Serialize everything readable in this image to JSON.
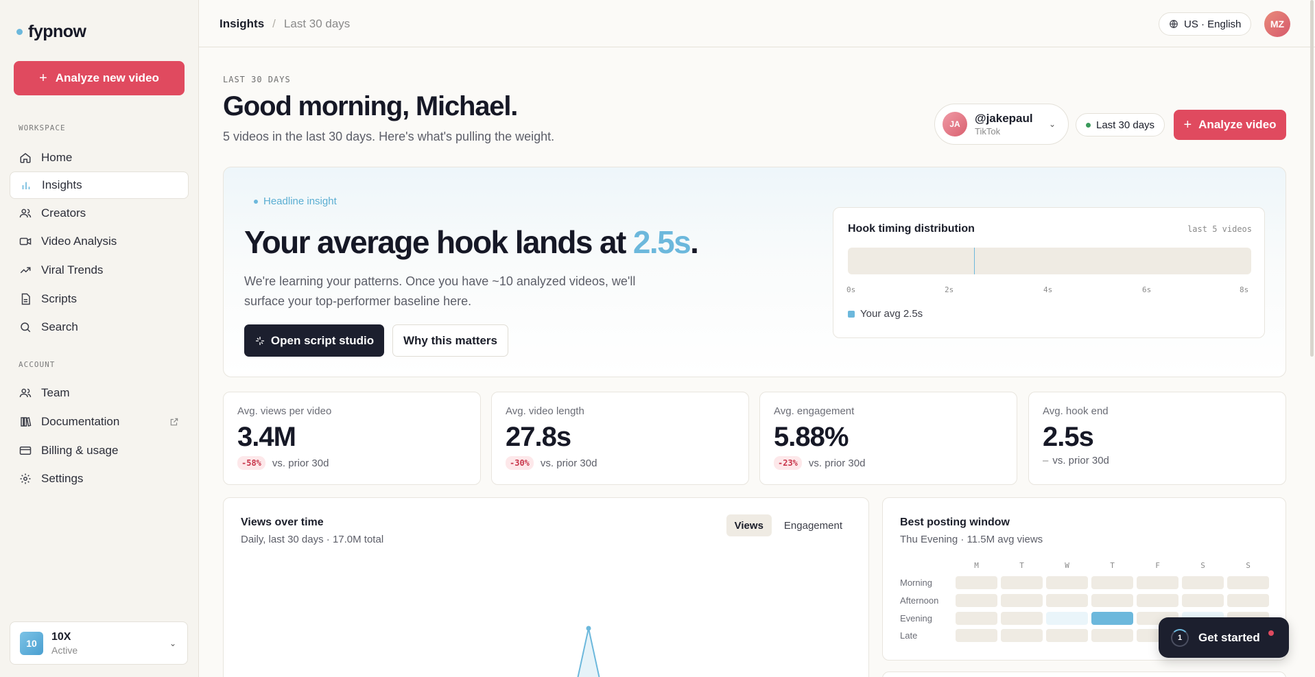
{
  "app": {
    "name": "fypnow"
  },
  "sidebar": {
    "cta": "Analyze new video",
    "workspace_label": "WORKSPACE",
    "account_label": "ACCOUNT",
    "workspace_items": [
      {
        "label": "Home",
        "icon": "home-icon"
      },
      {
        "label": "Insights",
        "icon": "bar-chart-icon",
        "active": true
      },
      {
        "label": "Creators",
        "icon": "users-icon"
      },
      {
        "label": "Video Analysis",
        "icon": "video-icon"
      },
      {
        "label": "Viral Trends",
        "icon": "trending-up-icon"
      },
      {
        "label": "Scripts",
        "icon": "document-icon"
      },
      {
        "label": "Search",
        "icon": "search-icon"
      }
    ],
    "account_items": [
      {
        "label": "Team",
        "icon": "users-icon"
      },
      {
        "label": "Documentation",
        "icon": "book-icon",
        "external": true
      },
      {
        "label": "Billing & usage",
        "icon": "credit-card-icon"
      },
      {
        "label": "Settings",
        "icon": "gear-icon"
      }
    ],
    "workspace_switcher": {
      "badge": "10",
      "name": "10X",
      "status": "Active"
    }
  },
  "topbar": {
    "breadcrumb": [
      "Insights",
      "Last 30 days"
    ],
    "language": "US · English",
    "user_initials": "MZ"
  },
  "header": {
    "eyebrow": "LAST 30 DAYS",
    "greeting": "Good morning, Michael.",
    "subtitle": "5 videos in the last 30 days. Here's what's pulling the weight.",
    "account": {
      "initials": "JA",
      "handle": "@jakepaul",
      "platform": "TikTok"
    },
    "range": "Last 30 days",
    "analyze_button": "Analyze video"
  },
  "headline": {
    "tag": "Headline insight",
    "title_prefix": "Your average hook lands at ",
    "title_value": "2.5s",
    "title_suffix": ".",
    "body": "We're learning your patterns. Once you have ~10 analyzed videos, we'll surface your top-performer baseline here.",
    "primary_button": "Open script studio",
    "secondary_button": "Why this matters",
    "hook_chart": {
      "title": "Hook timing distribution",
      "subtitle": "last 5 videos",
      "ticks": [
        "0s",
        "2s",
        "4s",
        "6s",
        "8s"
      ],
      "legend": "Your avg 2.5s",
      "avg_seconds": 2.5,
      "max_seconds": 8,
      "accent_color": "#6cb8dc"
    }
  },
  "stats": [
    {
      "label": "Avg. views per video",
      "value": "3.4M",
      "delta": "-58%",
      "compare": "vs. prior 30d"
    },
    {
      "label": "Avg. video length",
      "value": "27.8s",
      "delta": "-30%",
      "compare": "vs. prior 30d"
    },
    {
      "label": "Avg. engagement",
      "value": "5.88%",
      "delta": "-23%",
      "compare": "vs. prior 30d"
    },
    {
      "label": "Avg. hook end",
      "value": "2.5s",
      "delta": "–",
      "compare": "vs. prior 30d"
    }
  ],
  "views_chart": {
    "title": "Views over time",
    "subtitle": "Daily, last 30 days · 17.0M total",
    "toggle": [
      "Views",
      "Engagement"
    ],
    "active_toggle": "Views"
  },
  "posting_window": {
    "title": "Best posting window",
    "subtitle": "Thu Evening · 11.5M avg views",
    "days": [
      "M",
      "T",
      "W",
      "T",
      "F",
      "S",
      "S"
    ],
    "rows": [
      "Morning",
      "Afternoon",
      "Evening",
      "Late"
    ],
    "intensity": [
      [
        0,
        0,
        0,
        0,
        0,
        0,
        0
      ],
      [
        0,
        0,
        0,
        0,
        0,
        0,
        0
      ],
      [
        0,
        0,
        0.1,
        1,
        0,
        0.1,
        0
      ],
      [
        0,
        0,
        0,
        0,
        0,
        0.1,
        0
      ]
    ]
  },
  "get_started": {
    "label": "Get started",
    "step": "1"
  }
}
